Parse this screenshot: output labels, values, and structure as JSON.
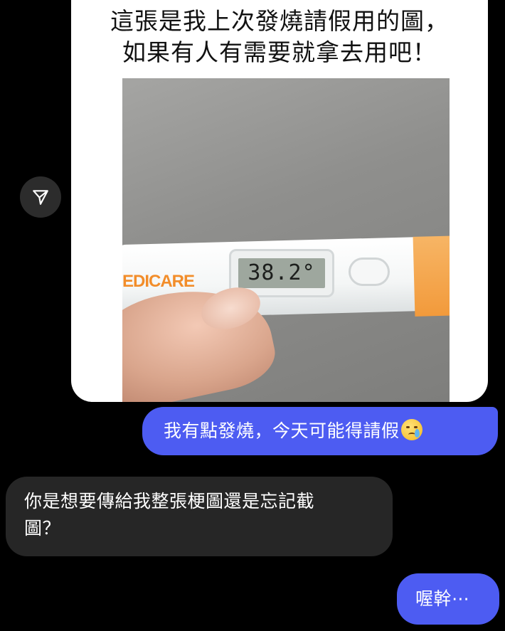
{
  "post": {
    "caption_line1": "這張是我上次發燒請假用的圖，",
    "caption_line2": "如果有人有需要就拿去用吧！",
    "photo": {
      "brand_text": "EDICARE",
      "display_reading": "38.2°"
    }
  },
  "share_icon": "paper-plane-icon",
  "messages": [
    {
      "side": "sent",
      "text": "我有點發燒，今天可能得請假",
      "emoji": "crying-face-emoji"
    },
    {
      "side": "received",
      "text_line1": "你是想要傳給我整張梗圖還是忘記截",
      "text_line2": "圖？"
    },
    {
      "side": "sent",
      "text": "喔幹⋯"
    }
  ],
  "colors": {
    "background": "#000000",
    "sent_bubble": "#4d5cf2",
    "received_bubble": "#262626",
    "post_card": "#ffffff",
    "thermometer_accent": "#f29a3b"
  }
}
